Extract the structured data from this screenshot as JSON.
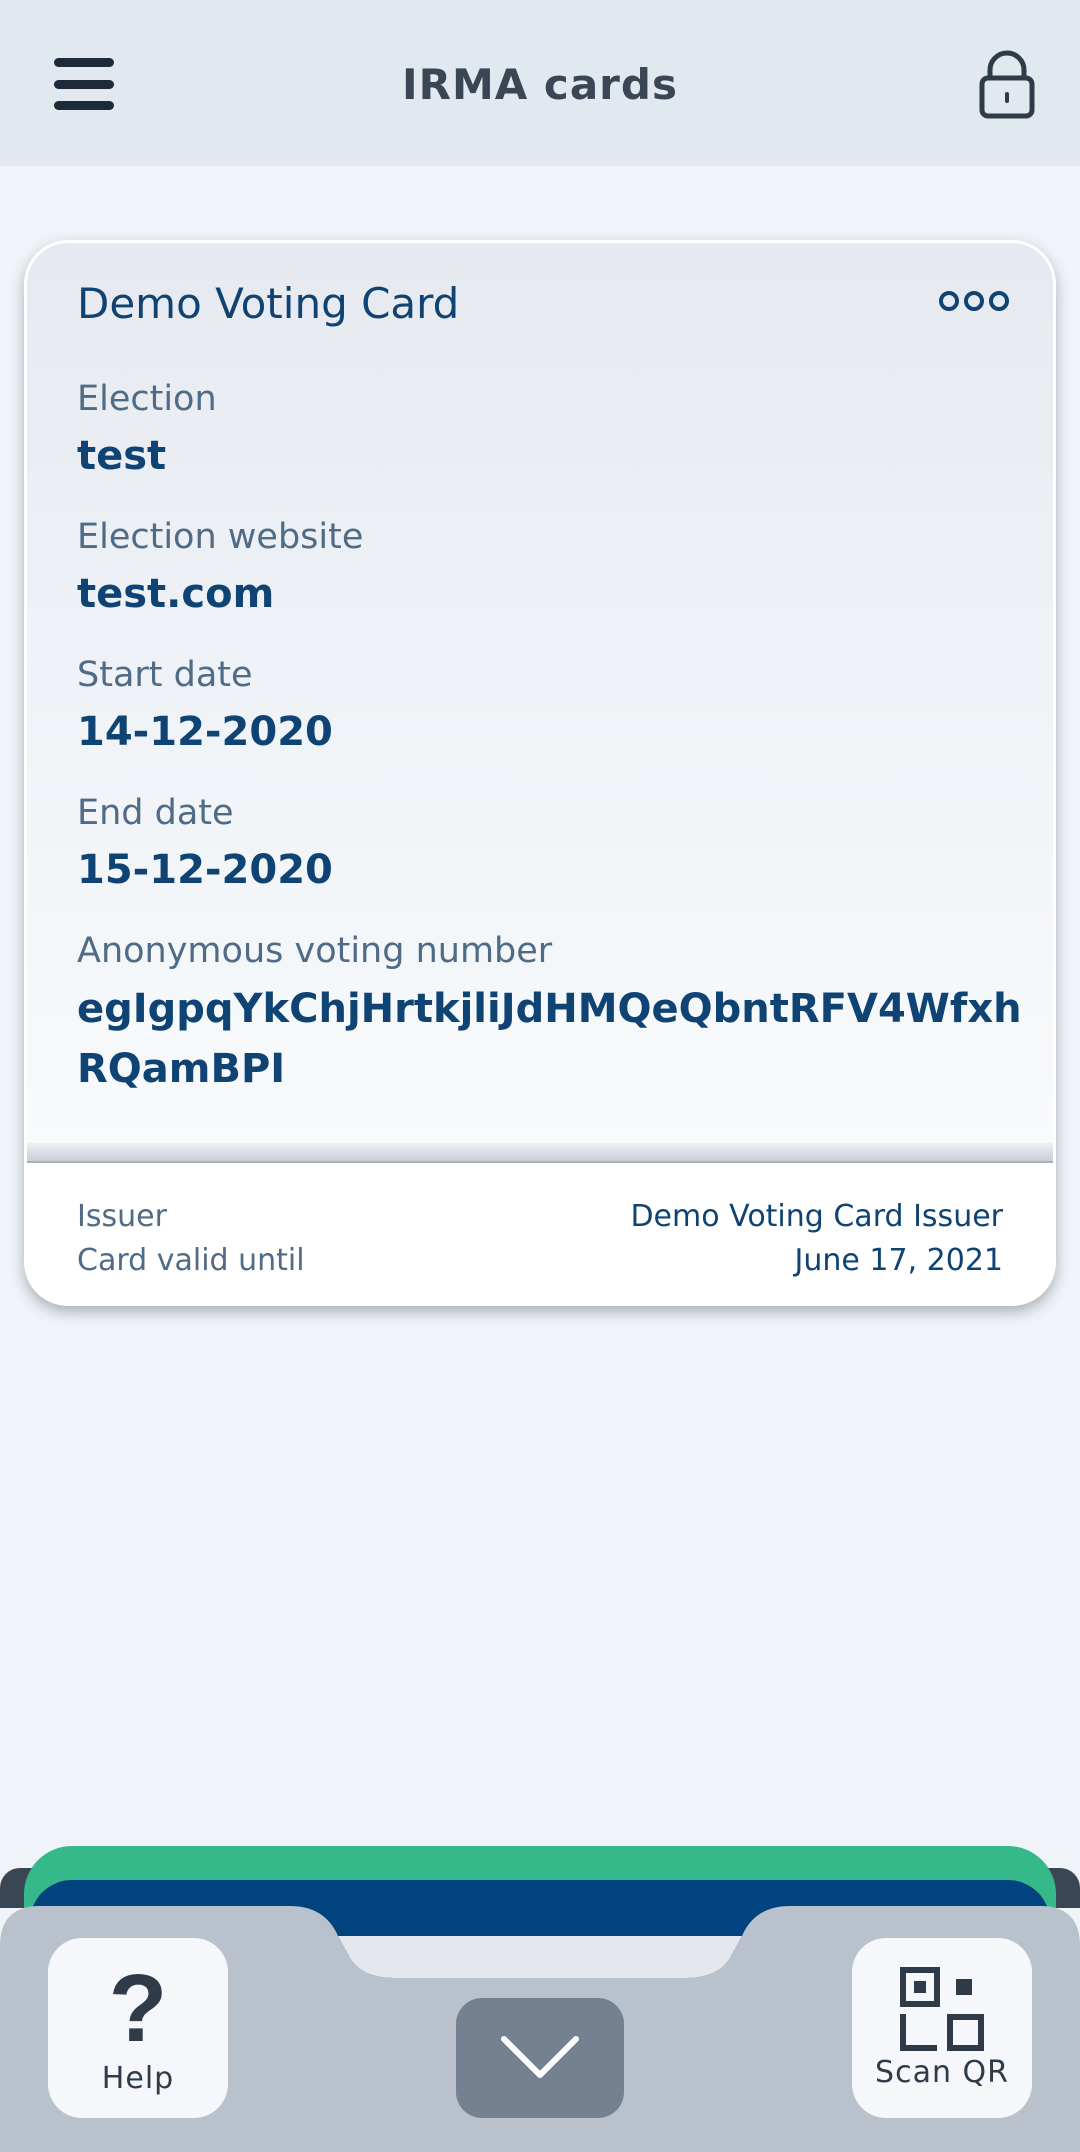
{
  "header": {
    "title": "IRMA cards",
    "menu_icon": "menu-icon",
    "lock_icon": "lock-icon"
  },
  "card": {
    "title": "Demo Voting Card",
    "more_icon": "more-options-icon",
    "attributes": [
      {
        "label": "Election",
        "value": "test"
      },
      {
        "label": "Election website",
        "value": "test.com"
      },
      {
        "label": "Start date",
        "value": "14-12-2020"
      },
      {
        "label": "End date",
        "value": "15-12-2020"
      },
      {
        "label": "Anonymous voting number",
        "value": "egIgpqYkChjHrtkjliJdHMQeQbntRFV4WfxhRQamBPI"
      }
    ],
    "footer": {
      "issuer_label": "Issuer",
      "issuer_value": "Demo Voting Card Issuer",
      "valid_label": "Card valid until",
      "valid_value": "June 17, 2021"
    }
  },
  "bottom_bar": {
    "help_label": "Help",
    "help_icon": "question-mark-icon",
    "collapse_icon": "chevron-down-icon",
    "scan_label": "Scan QR",
    "scan_icon": "qr-code-icon"
  },
  "colors": {
    "primary_text": "#0f4374",
    "label_text": "#4f6b86",
    "header_bg": "#e2e8f0",
    "page_bg": "#f0f4f8",
    "stack_green": "#35b88a",
    "stack_blue": "#00437f",
    "bottom_bar_bg": "#b8c1cc"
  }
}
